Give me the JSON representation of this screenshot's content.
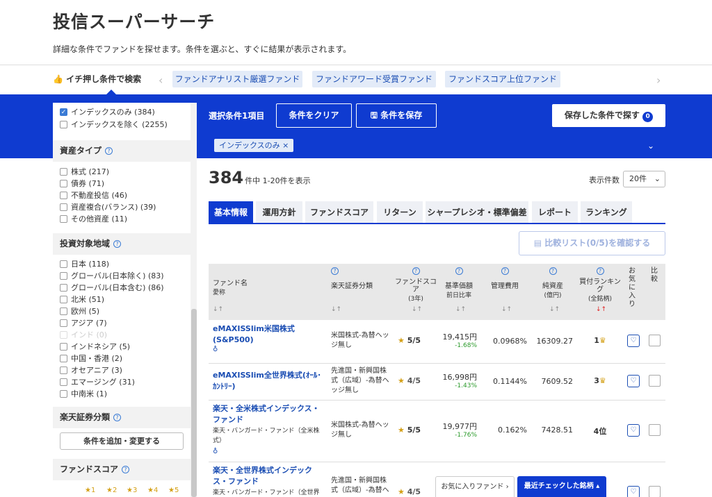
{
  "header": {
    "title": "投信スーパーサーチ",
    "description": "詳細な条件でファンドを探せます。条件を選ぶと、すぐに結果が表示されます。"
  },
  "quick": {
    "label": "イチ押し条件で検索",
    "chips": [
      "ファンドアナリスト厳選ファンド",
      "ファンドアワード受賞ファンド",
      "ファンドスコア上位ファンド"
    ]
  },
  "sidebar": {
    "index_options": [
      {
        "label": "インデックスのみ (384)",
        "checked": true
      },
      {
        "label": "インデックスを除く (2255)",
        "checked": false
      }
    ],
    "asset_title": "資産タイプ",
    "asset_options": [
      "株式 (217)",
      "債券 (71)",
      "不動産投信 (46)",
      "資産複合(バランス) (39)",
      "その他資産 (11)"
    ],
    "region_title": "投資対象地域",
    "region_options": [
      "日本 (118)",
      "グローバル(日本除く) (83)",
      "グローバル(日本含む) (86)",
      "北米 (51)",
      "欧州 (5)",
      "アジア (7)",
      "インド (0)",
      "インドネシア (5)",
      "中国・香港 (2)",
      "オセアニア (3)",
      "エマージング (31)",
      "中南米 (1)"
    ],
    "rakuten_title": "楽天証券分類",
    "add_button": "条件を追加・変更する",
    "score_title": "ファンドスコア",
    "score_stars": [
      "★1",
      "★2",
      "★3",
      "★4",
      "★5"
    ]
  },
  "band": {
    "selected": "選択条件1項目",
    "clear": "条件をクリア",
    "save": "条件を保存",
    "search_saved": "保存した条件で探す",
    "saved_count": "0",
    "tag": "インデックスのみ ×"
  },
  "results": {
    "count": "384",
    "count_suffix": "件中 1-20件を表示",
    "per_page_label": "表示件数",
    "per_page_value": "20件",
    "compare": "比較リスト(0/5)を確認する"
  },
  "tabs": [
    "基本情報",
    "運用方針",
    "ファンドスコア",
    "リターン",
    "シャープレシオ・標準偏差",
    "レポート",
    "ランキング"
  ],
  "table": {
    "headers": {
      "name": "ファンド名",
      "name_sub": "愛称",
      "category": "楽天証券分類",
      "score": "ファンドスコア",
      "score_sub": "(3年)",
      "nav": "基準価額",
      "nav_sub": "前日比率",
      "fee": "管理費用",
      "assets": "純資産",
      "assets_sub": "(億円)",
      "rank": "買付ランキング",
      "rank_sub": "(全銘柄)",
      "fav": "お気に入り",
      "compare": "比較",
      "sort": "↓↑"
    },
    "rows": [
      {
        "name": "eMAXISSlim米国株式(S&P500)",
        "sub": "",
        "category": "米国株式-為替ヘッジ無し",
        "score": "5",
        "score_max": "/5",
        "nav": "19,415円",
        "change": "-1.68%",
        "fee": "0.0968%",
        "assets": "16309.27",
        "rank": "1"
      },
      {
        "name": "eMAXISSlim全世界株式(ｵｰﾙ･ｶﾝﾄﾘｰ)",
        "sub": "",
        "category": "先進国・新興国株式（広域）-為替ヘッジ無し",
        "score": "4",
        "score_max": "/5",
        "nav": "16,998円",
        "change": "-1.43%",
        "fee": "0.1144%",
        "assets": "7609.52",
        "rank": "3"
      },
      {
        "name": "楽天・全米株式インデックス・ファンド",
        "sub": "楽天・バンガード・ファンド（全米株式）",
        "category": "米国株式-為替ヘッジ無し",
        "score": "5",
        "score_max": "/5",
        "nav": "19,977円",
        "change": "-1.76%",
        "fee": "0.162%",
        "assets": "7428.51",
        "rank": "4位"
      },
      {
        "name": "楽天・全世界株式インデックス・ファンド",
        "sub": "楽天・バンガード・ファンド（全世界",
        "category": "先進国・新興国株式（広域）-為替ヘ",
        "score": "4",
        "score_max": "/5",
        "nav": "",
        "change": "",
        "fee": "",
        "assets": "",
        "rank": ""
      }
    ]
  },
  "floating": {
    "fav": "お気に入りファンド",
    "recent": "最近チェックした銘柄"
  }
}
